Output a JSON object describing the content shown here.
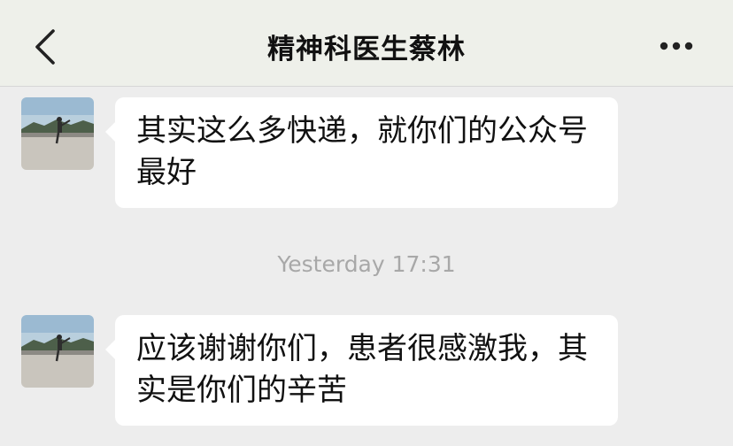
{
  "header": {
    "title": "精神科医生蔡林",
    "back_icon": "chevron-left-icon",
    "more_icon": "ellipsis-icon"
  },
  "messages": [
    {
      "text": "其实这么多快递，就你们的公众号最好"
    },
    {
      "text": "应该谢谢你们，患者很感激我，其实是你们的辛苦"
    }
  ],
  "timestamp": "Yesterday 17:31",
  "colors": {
    "background": "#ededed",
    "header_background": "#eef0ea",
    "bubble": "#ffffff",
    "timestamp_text": "#a8a8a8"
  }
}
